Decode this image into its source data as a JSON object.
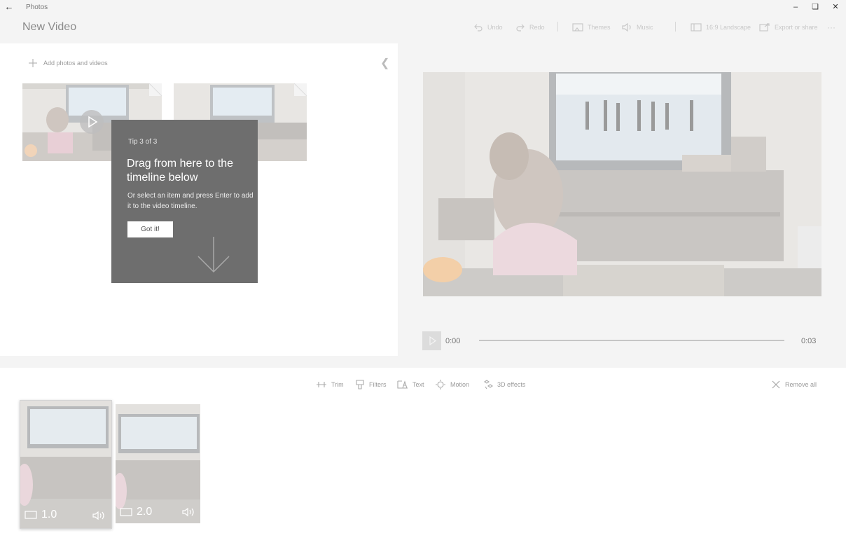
{
  "app": {
    "title": "Photos",
    "page_title": "New Video"
  },
  "toolbar": {
    "undo": "Undo",
    "redo": "Redo",
    "theme": "Themes",
    "music": "Music",
    "aspect": "16:9 Landscape",
    "export": "Export or share",
    "more": "···"
  },
  "library": {
    "add_label": "Add photos and videos",
    "tip": {
      "count": "Tip 3 of 3",
      "heading": "Drag from here to the timeline below",
      "body": "Or select an item and press Enter to add it to the video timeline.",
      "button": "Got it!"
    }
  },
  "player": {
    "current_time": "0:00",
    "duration": "0:03"
  },
  "timeline_tools": {
    "trim": "Trim",
    "filters": "Filters",
    "text": "Text",
    "motion": "Motion",
    "effects": "3D effects",
    "remove_all": "Remove all"
  },
  "storyboard": {
    "clips": [
      {
        "duration": "1.0"
      },
      {
        "duration": "2.0"
      }
    ]
  },
  "colors": {
    "tip_background": "#6e6e6e",
    "panel": "#ffffff",
    "backdrop": "#f4f4f4"
  },
  "icons": [
    "back-arrow-icon",
    "minimize-icon",
    "maximize-icon",
    "close-icon",
    "undo-icon",
    "redo-icon",
    "theme-icon",
    "music-icon",
    "aspect-icon",
    "export-icon",
    "plus-icon",
    "chevron-left-icon",
    "play-icon",
    "down-arrow-icon",
    "trim-icon",
    "filters-icon",
    "text-icon",
    "motion-icon",
    "3d-effects-icon",
    "remove-icon",
    "clip-frame-icon",
    "speaker-icon"
  ]
}
